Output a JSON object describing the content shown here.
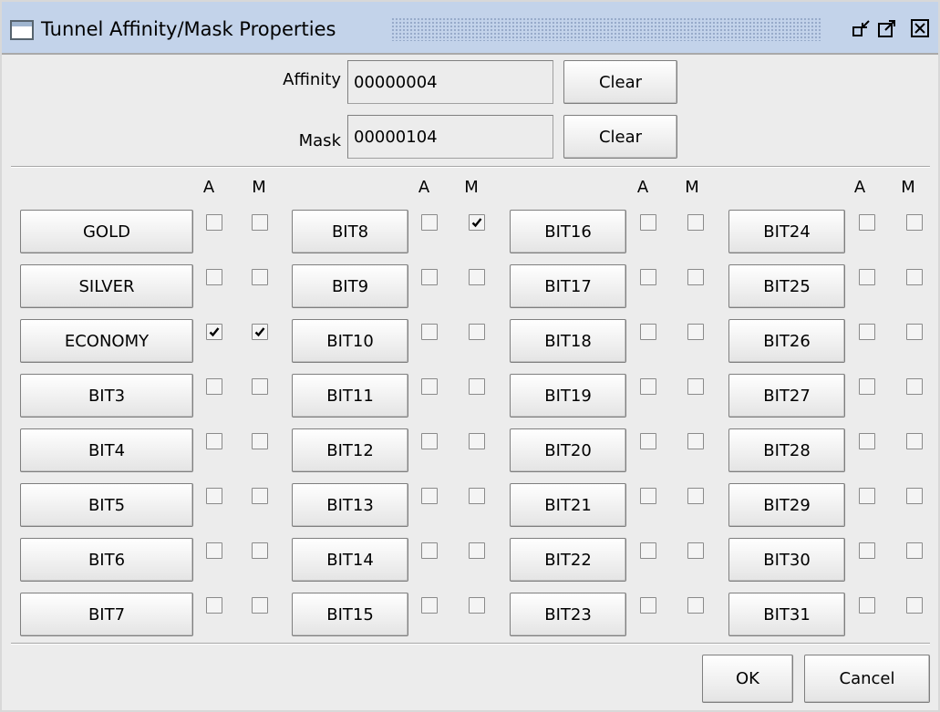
{
  "window": {
    "title": "Tunnel Affinity/Mask Properties"
  },
  "affinity": {
    "label": "Affinity",
    "value": "00000004",
    "clear_label": "Clear"
  },
  "mask": {
    "label": "Mask",
    "value": "00000104",
    "clear_label": "Clear"
  },
  "columns": [
    {
      "a_header": "A",
      "m_header": "M"
    },
    {
      "a_header": "A",
      "m_header": "M"
    },
    {
      "a_header": "A",
      "m_header": "M"
    },
    {
      "a_header": "A",
      "m_header": "M"
    }
  ],
  "bits": [
    {
      "label": "GOLD",
      "a": false,
      "m": false
    },
    {
      "label": "SILVER",
      "a": false,
      "m": false
    },
    {
      "label": "ECONOMY",
      "a": true,
      "m": true
    },
    {
      "label": "BIT3",
      "a": false,
      "m": false
    },
    {
      "label": "BIT4",
      "a": false,
      "m": false
    },
    {
      "label": "BIT5",
      "a": false,
      "m": false
    },
    {
      "label": "BIT6",
      "a": false,
      "m": false
    },
    {
      "label": "BIT7",
      "a": false,
      "m": false
    },
    {
      "label": "BIT8",
      "a": false,
      "m": true
    },
    {
      "label": "BIT9",
      "a": false,
      "m": false
    },
    {
      "label": "BIT10",
      "a": false,
      "m": false
    },
    {
      "label": "BIT11",
      "a": false,
      "m": false
    },
    {
      "label": "BIT12",
      "a": false,
      "m": false
    },
    {
      "label": "BIT13",
      "a": false,
      "m": false
    },
    {
      "label": "BIT14",
      "a": false,
      "m": false
    },
    {
      "label": "BIT15",
      "a": false,
      "m": false
    },
    {
      "label": "BIT16",
      "a": false,
      "m": false
    },
    {
      "label": "BIT17",
      "a": false,
      "m": false
    },
    {
      "label": "BIT18",
      "a": false,
      "m": false
    },
    {
      "label": "BIT19",
      "a": false,
      "m": false
    },
    {
      "label": "BIT20",
      "a": false,
      "m": false
    },
    {
      "label": "BIT21",
      "a": false,
      "m": false
    },
    {
      "label": "BIT22",
      "a": false,
      "m": false
    },
    {
      "label": "BIT23",
      "a": false,
      "m": false
    },
    {
      "label": "BIT24",
      "a": false,
      "m": false
    },
    {
      "label": "BIT25",
      "a": false,
      "m": false
    },
    {
      "label": "BIT26",
      "a": false,
      "m": false
    },
    {
      "label": "BIT27",
      "a": false,
      "m": false
    },
    {
      "label": "BIT28",
      "a": false,
      "m": false
    },
    {
      "label": "BIT29",
      "a": false,
      "m": false
    },
    {
      "label": "BIT30",
      "a": false,
      "m": false
    },
    {
      "label": "BIT31",
      "a": false,
      "m": false
    }
  ],
  "footer": {
    "ok_label": "OK",
    "cancel_label": "Cancel"
  },
  "icons": {
    "window": "window-icon",
    "minimize": "minimize-icon",
    "maximize": "maximize-icon",
    "close": "close-icon",
    "check": "checkmark-icon"
  }
}
